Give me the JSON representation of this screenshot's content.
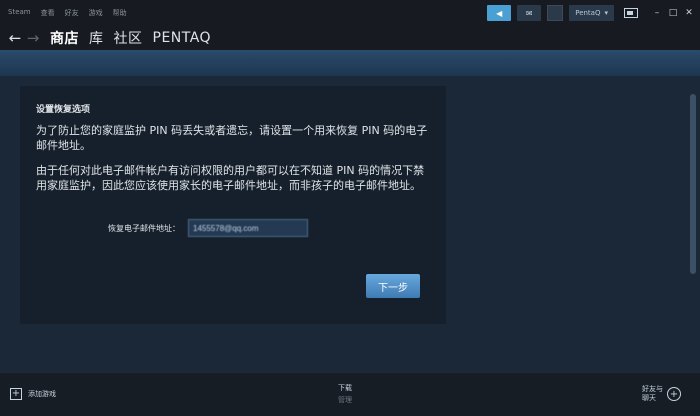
{
  "titlebar": {
    "menu": [
      "Steam",
      "查看",
      "好友",
      "游戏",
      "帮助"
    ],
    "account_name": "PentaQ",
    "notif_icon": "megaphone-icon",
    "mail_icon": "mail-icon"
  },
  "nav": {
    "back": "←",
    "forward": "→",
    "links": [
      "商店",
      "库",
      "社区",
      "PENTAQ"
    ]
  },
  "dialog": {
    "title": "设置恢复选项",
    "para1": "为了防止您的家庭监护 PIN 码丢失或者遗忘，请设置一个用来恢复 PIN 码的电子邮件地址。",
    "para2": "由于任何对此电子邮件帐户有访问权限的用户都可以在不知道 PIN 码的情况下禁用家庭监护，因此您应该使用家长的电子邮件地址，而非孩子的电子邮件地址。",
    "email_label": "恢复电子邮件地址：",
    "email_value": "1455578@qq.com",
    "next_label": "下一步"
  },
  "bottom": {
    "add_game": "添加游戏",
    "downloads": "下载",
    "manage": "管理",
    "friends_line1": "好友与",
    "friends_line2": "聊天"
  }
}
